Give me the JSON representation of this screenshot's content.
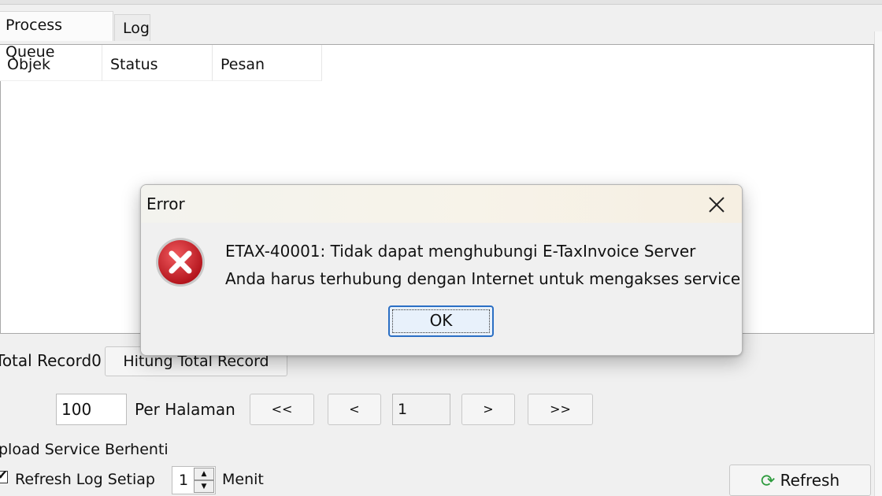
{
  "tabs": [
    {
      "label": "Process Queue",
      "active": true
    },
    {
      "label": "Log",
      "active": false
    }
  ],
  "table": {
    "columns": [
      "Objek",
      "Status",
      "Pesan"
    ],
    "rows": []
  },
  "total_record": {
    "label": "Total Record",
    "value": "0",
    "count_button": "Hitung Total Record"
  },
  "pagination": {
    "per_page_value": "100",
    "per_page_label": "Per Halaman",
    "first": "<<",
    "prev": "<",
    "page": "1",
    "next": ">",
    "last": ">>"
  },
  "upload_status": "pload Service Berhenti",
  "refresh": {
    "checkbox_label": "Refresh Log Setiap",
    "checked": true,
    "interval_value": "1",
    "unit_label": "Menit",
    "button_label": "Refresh"
  },
  "dialog": {
    "title": "Error",
    "line1": "ETAX-40001: Tidak dapat menghubungi E-TaxInvoice Server",
    "line2": "Anda harus terhubung dengan Internet untuk mengakses service",
    "ok_label": "OK",
    "icon": "error-icon"
  },
  "colors": {
    "error_red": "#d3202a",
    "ok_border": "#2b6fc4",
    "refresh_green": "#2e9b3e"
  }
}
